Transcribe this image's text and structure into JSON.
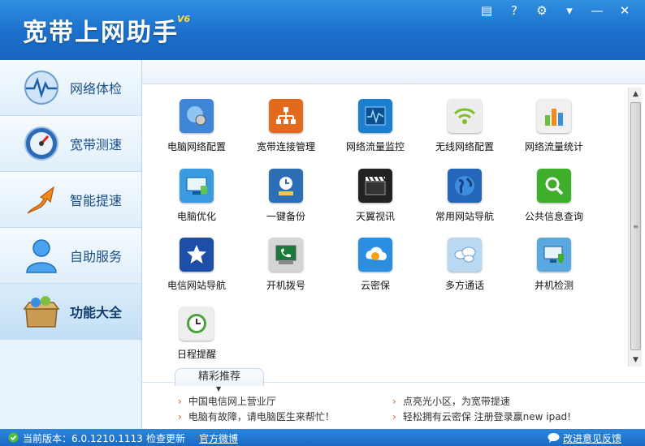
{
  "app": {
    "title": "宽带上网助手",
    "version": "V6"
  },
  "window_buttons": [
    {
      "name": "skin-button",
      "icon": "shirt-icon",
      "glyph": "▤"
    },
    {
      "name": "help-button",
      "icon": "question-icon",
      "glyph": "?"
    },
    {
      "name": "settings-button",
      "icon": "gear-icon",
      "glyph": "⚙"
    },
    {
      "name": "menu-button",
      "icon": "dropdown-menu-icon",
      "glyph": "▾"
    },
    {
      "name": "minimize-button",
      "icon": "minimize-icon",
      "glyph": "—"
    },
    {
      "name": "close-button",
      "icon": "close-icon",
      "glyph": "✕"
    }
  ],
  "sidebar": {
    "items": [
      {
        "label": "网络体检",
        "icon": "heartbeat-globe-icon"
      },
      {
        "label": "宽带测速",
        "icon": "speedometer-icon"
      },
      {
        "label": "智能提速",
        "icon": "rocket-arrow-icon"
      },
      {
        "label": "自助服务",
        "icon": "person-icon"
      },
      {
        "label": "功能大全",
        "icon": "toolbox-icon",
        "active": true
      }
    ]
  },
  "tools": [
    {
      "label": "电脑网络配置",
      "icon": "network-gear-icon",
      "color": "#3f86d8"
    },
    {
      "label": "宽带连接管理",
      "icon": "connection-tree-icon",
      "color": "#e36a1c"
    },
    {
      "label": "网络流量监控",
      "icon": "traffic-monitor-icon",
      "color": "#1b7fd0"
    },
    {
      "label": "无线网络配置",
      "icon": "wifi-icon",
      "color": "#e9e9e9"
    },
    {
      "label": "网络流量统计",
      "icon": "bar-stats-icon",
      "color": "#eeeeee"
    },
    {
      "label": "电脑优化",
      "icon": "computer-optimize-icon",
      "color": "#3a9be0"
    },
    {
      "label": "一键备份",
      "icon": "backup-clock-icon",
      "color": "#2c6fb5"
    },
    {
      "label": "天翼视讯",
      "icon": "clapperboard-icon",
      "color": "#222222"
    },
    {
      "label": "常用网站导航",
      "icon": "globe-map-icon",
      "color": "#2467b8"
    },
    {
      "label": "公共信息查询",
      "icon": "search-magnifier-icon",
      "color": "#3fae2a"
    },
    {
      "label": "电信网站导航",
      "icon": "star-icon",
      "color": "#1e4fa8"
    },
    {
      "label": "开机拨号",
      "icon": "dialup-phone-icon",
      "color": "#cfcfcf"
    },
    {
      "label": "云密保",
      "icon": "cloud-shield-icon",
      "color": "#2a8fe0"
    },
    {
      "label": "多方通话",
      "icon": "talk-bubbles-icon",
      "color": "#b9d9f2"
    },
    {
      "label": "并机检测",
      "icon": "monitor-shield-icon",
      "color": "#5aa8e0"
    },
    {
      "label": "日程提醒",
      "icon": "green-clock-icon",
      "color": "#4aa33a"
    }
  ],
  "recommend": {
    "tab_label": "精彩推荐",
    "links": [
      "中国电信网上营业厅",
      "点亮光小区，为宽带提速",
      "电脑有故障，请电脑医生来帮忙！",
      "轻松拥有云密保 注册登录赢new ipad!"
    ]
  },
  "status": {
    "version_label": "当前版本：6.0.1210.1113",
    "check_update": "检查更新",
    "weibo": "官方微博",
    "feedback": "改进意见反馈"
  },
  "colors": {
    "titlebar": "#1b6fcb",
    "statusbar": "#1a6ac4",
    "sidebar_text": "#1a4f8a",
    "link_marker": "#d25c28"
  }
}
